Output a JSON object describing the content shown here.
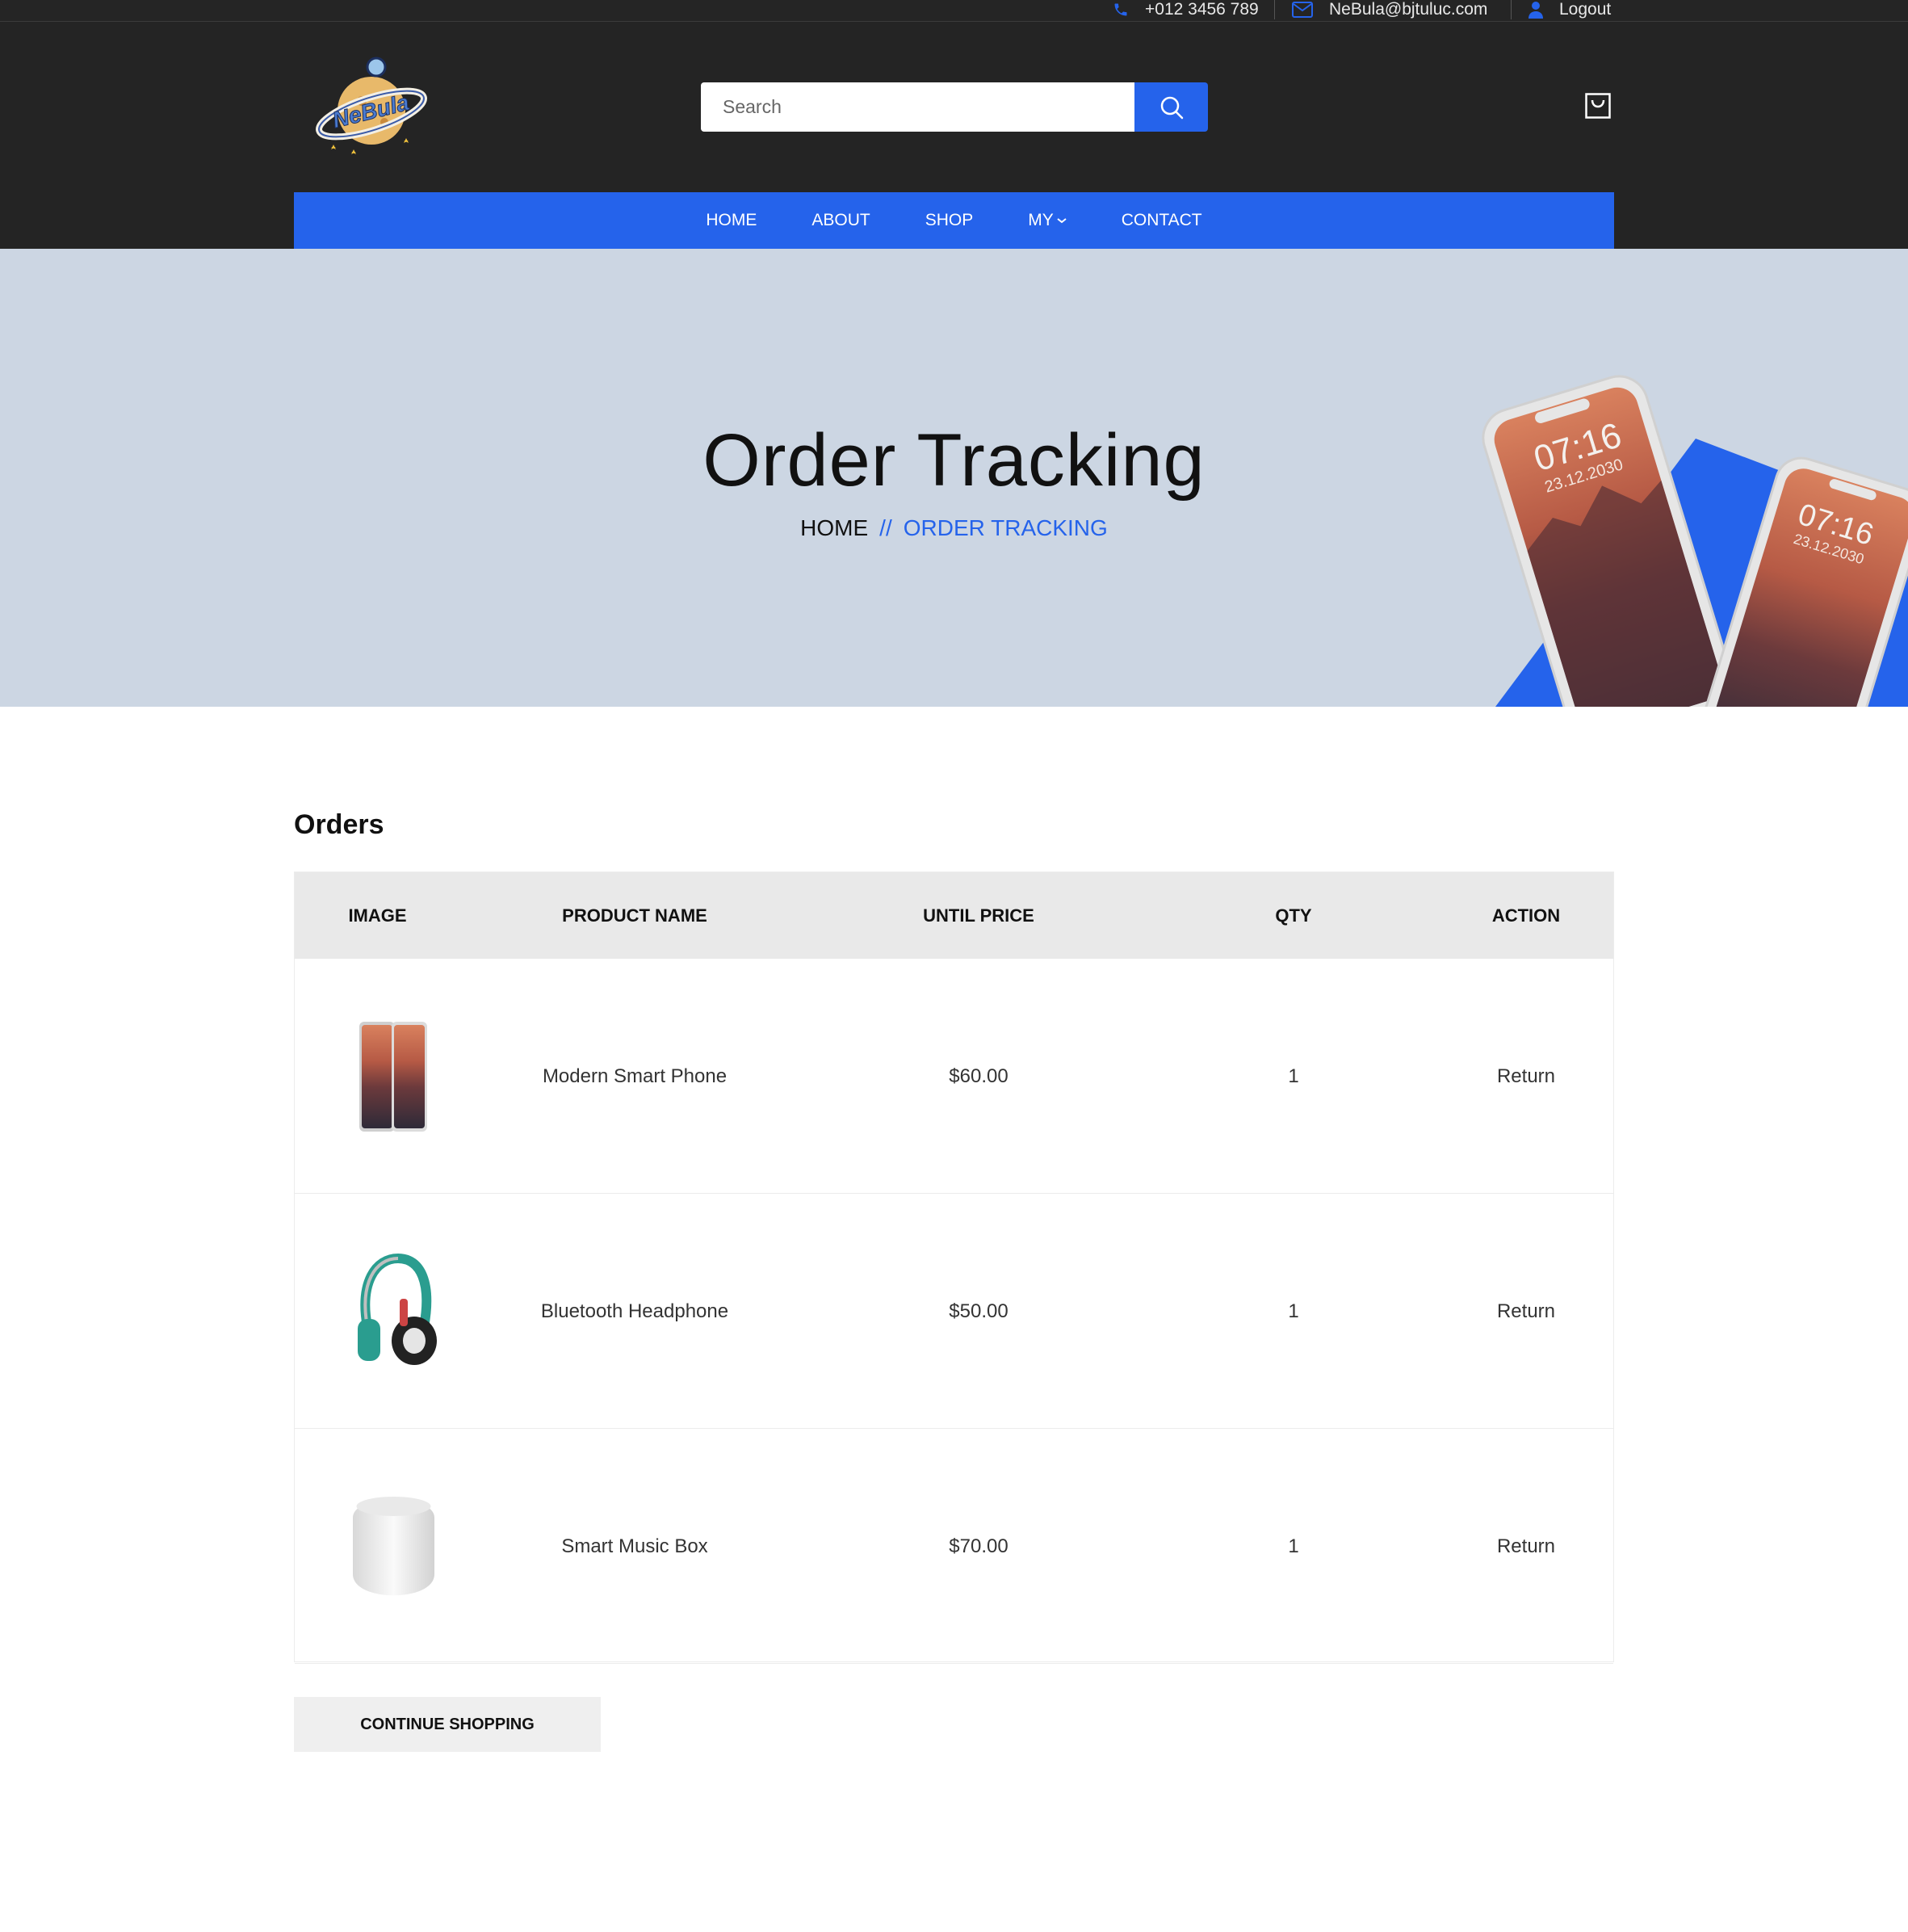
{
  "topbar": {
    "phone": "+012 3456 789",
    "email": "NeBula@bjtuluc.com",
    "account": "Logout"
  },
  "header": {
    "logo_text": "NeBula",
    "search_placeholder": "Search"
  },
  "nav": {
    "items": [
      "HOME",
      "ABOUT",
      "SHOP",
      "MY",
      "CONTACT"
    ]
  },
  "hero": {
    "title": "Order Tracking",
    "breadcrumb_home": "HOME",
    "breadcrumb_sep": "//",
    "breadcrumb_current": "ORDER TRACKING",
    "phone_time": "07:16",
    "phone_date": "23.12.2030"
  },
  "orders": {
    "title": "Orders",
    "columns": [
      "IMAGE",
      "PRODUCT NAME",
      "UNTIL PRICE",
      "QTY",
      "ACTION"
    ],
    "rows": [
      {
        "name": "Modern Smart Phone",
        "price": "$60.00",
        "qty": "1",
        "action": "Return"
      },
      {
        "name": "Bluetooth Headphone",
        "price": "$50.00",
        "qty": "1",
        "action": "Return"
      },
      {
        "name": "Smart Music Box",
        "price": "$70.00",
        "qty": "1",
        "action": "Return"
      }
    ]
  },
  "continue_label": "CONTINUE SHOPPING",
  "colors": {
    "accent": "#2563eb",
    "dark": "#242424",
    "hero_bg": "#ccd6e3"
  }
}
